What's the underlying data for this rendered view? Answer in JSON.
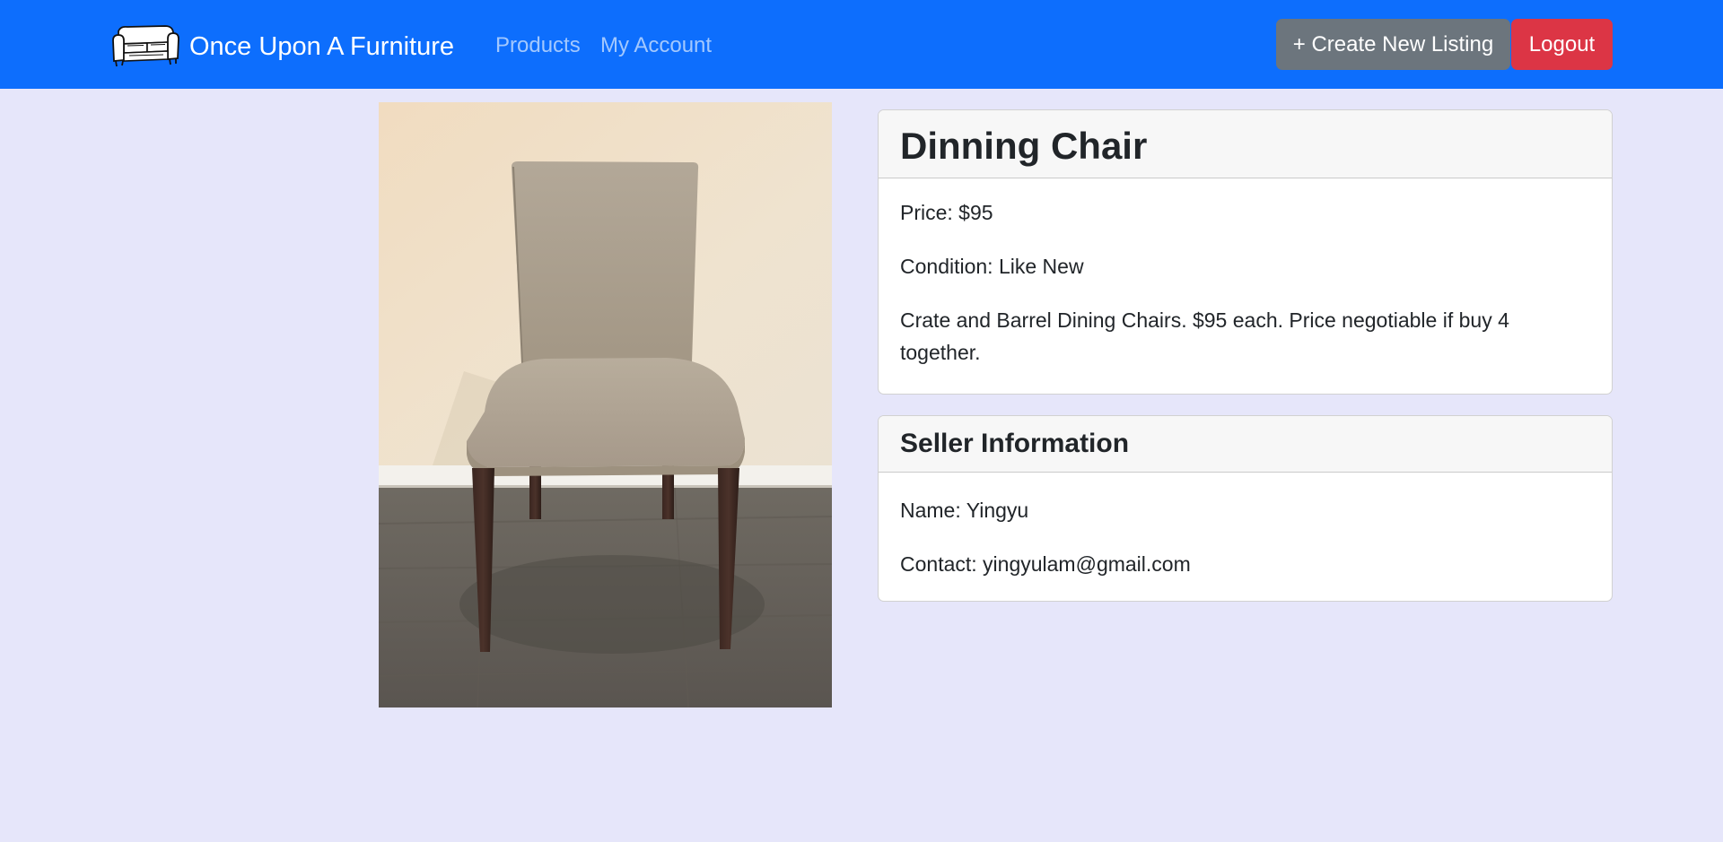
{
  "navbar": {
    "brand": "Once Upon A Furniture",
    "brand_logo_icon": "sofa-icon",
    "links": [
      {
        "label": "Products"
      },
      {
        "label": "My Account"
      }
    ],
    "create_button": "+ Create New Listing",
    "logout_button": "Logout"
  },
  "product": {
    "image_icon": "dining-chair-photo",
    "title": "Dinning Chair",
    "price": "Price: $95",
    "condition": "Condition: Like New",
    "description": "Crate and Barrel Dining Chairs. $95 each. Price negotiable if buy 4 together."
  },
  "seller": {
    "header": "Seller Information",
    "name": "Name: Yingyu",
    "contact": "Contact: yingyulam@gmail.com"
  },
  "colors": {
    "navbar": "#0d6efd",
    "page_background": "#e6e6fa",
    "create_button": "#6c757d",
    "logout_button": "#dc3545",
    "card_header": "#f7f7f7"
  }
}
